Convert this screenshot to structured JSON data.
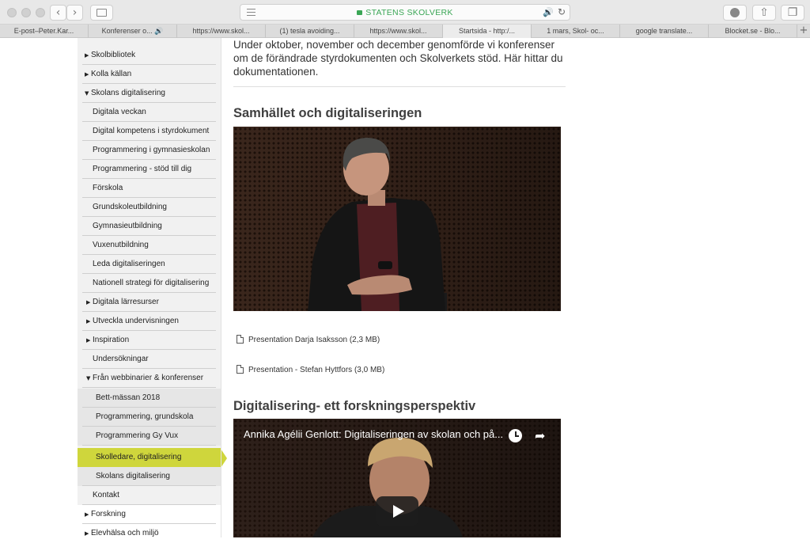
{
  "browser": {
    "site_label": "STATENS SKOLVERK",
    "tabs": [
      {
        "label": "E-post–Peter.Kar..."
      },
      {
        "label": "Konferenser o... 🔊"
      },
      {
        "label": "https://www.skol..."
      },
      {
        "label": "(1) tesla avoiding..."
      },
      {
        "label": "https://www.skol..."
      },
      {
        "label": "Startsida - http:/..."
      },
      {
        "label": "1 mars, Skol- oc..."
      },
      {
        "label": "google translate..."
      },
      {
        "label": "Blocket.se - Blo..."
      }
    ],
    "accent_color": "#3aa655"
  },
  "sidebar": {
    "items": [
      {
        "label": "Skolbibliotek"
      },
      {
        "label": "Kolla källan"
      },
      {
        "label": "Skolans digitalisering"
      },
      {
        "label": "Digitala veckan"
      },
      {
        "label": "Digital kompetens i styrdokument"
      },
      {
        "label": "Programmering i gymnasieskolan"
      },
      {
        "label": "Programmering - stöd till dig"
      },
      {
        "label": "Förskola"
      },
      {
        "label": "Grundskoleutbildning"
      },
      {
        "label": "Gymnasieutbildning"
      },
      {
        "label": "Vuxenutbildning"
      },
      {
        "label": "Leda digitaliseringen"
      },
      {
        "label": "Nationell strategi för digitalisering"
      },
      {
        "label": "Digitala lärresurser"
      },
      {
        "label": "Utveckla undervisningen"
      },
      {
        "label": "Inspiration"
      },
      {
        "label": "Undersökningar"
      },
      {
        "label": "Från webbinarier & konferenser"
      },
      {
        "label": "Bett-mässan 2018"
      },
      {
        "label": "Programmering, grundskola"
      },
      {
        "label": "Programmering Gy Vux"
      },
      {
        "label": "Skolledare, digitalisering"
      },
      {
        "label": "Skolans digitalisering"
      },
      {
        "label": "Kontakt"
      },
      {
        "label": "Forskning"
      },
      {
        "label": "Elevhälsa och miljö"
      }
    ],
    "selected_color": "#cfd63c"
  },
  "main": {
    "intro": "Under oktober, november och december genomförde vi konferenser om de förändrade styrdokumenten och Skolverkets stöd. Här hittar du dokumentationen.",
    "section1_heading": "Samhället och digitaliseringen",
    "downloads": [
      {
        "label": "Presentation Darja Isaksson (2,3 MB)"
      },
      {
        "label": "Presentation - Stefan Hyttfors (3,0 MB)"
      }
    ],
    "section2_heading": "Digitalisering- ett forskningsperspektiv",
    "video2_title": "Annika Agélii Genlott: Digitaliseringen av skolan och på..."
  }
}
